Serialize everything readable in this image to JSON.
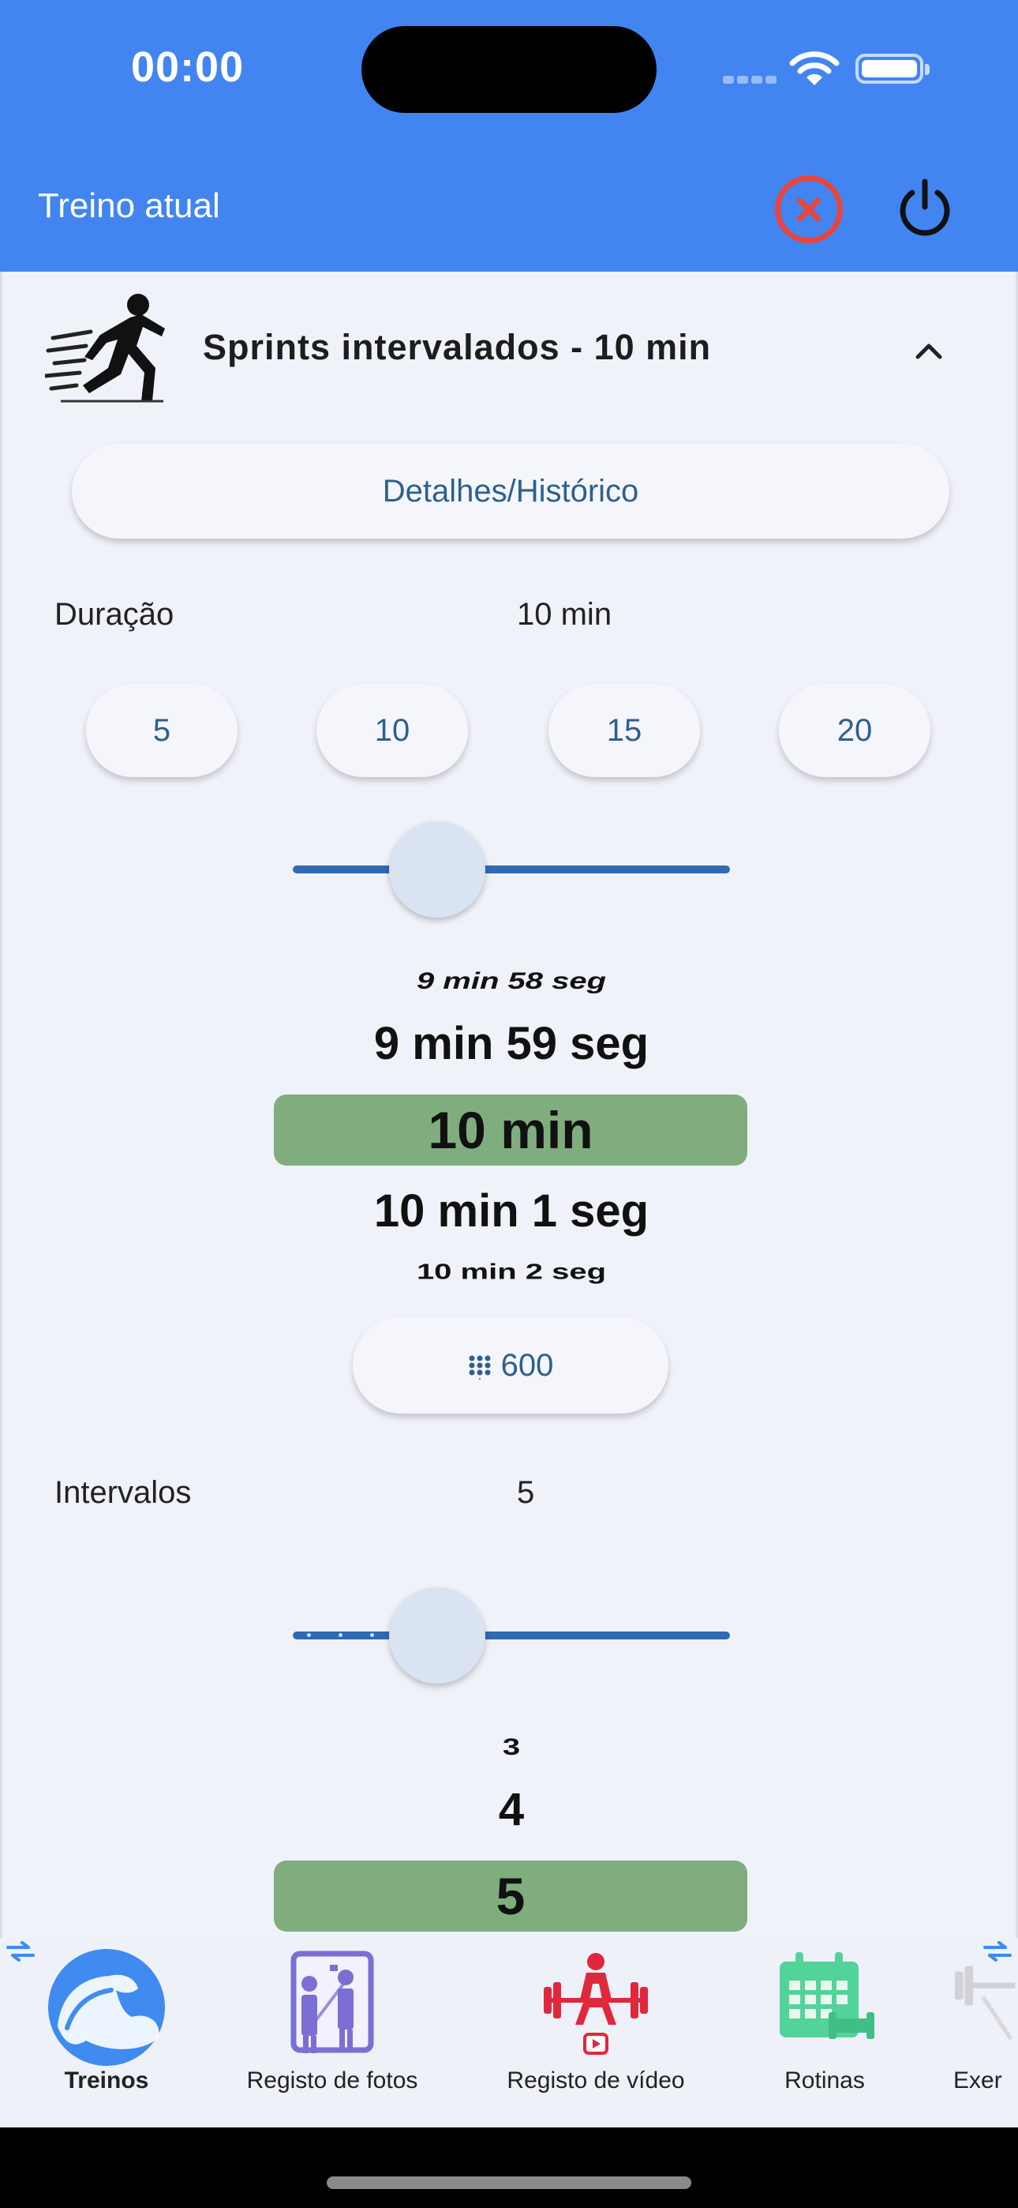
{
  "status_bar": {
    "time": "00:00"
  },
  "app_bar": {
    "title": "Treino atual"
  },
  "card": {
    "title": "Sprints intervalados - 10 min",
    "details_button": "Detalhes/Histórico",
    "duration": {
      "label": "Duração",
      "value": "10 min",
      "presets": [
        "5",
        "10",
        "15",
        "20"
      ],
      "slider_fraction": 0.33,
      "picker": [
        "9 min 58 seg",
        "9 min 59 seg",
        "10 min",
        "10 min 1 seg",
        "10 min 2 seg"
      ],
      "numeric_button": "600"
    },
    "intervals": {
      "label": "Intervalos",
      "value": "5",
      "slider_fraction": 0.33,
      "picker": [
        "3",
        "4",
        "5"
      ]
    }
  },
  "bottom_nav": {
    "items": [
      {
        "label": "Treinos",
        "icon": "biceps-icon",
        "active": true
      },
      {
        "label": "Registo de fotos",
        "icon": "photo-log-icon"
      },
      {
        "label": "Registo de vídeo",
        "icon": "weightlifting-video-icon"
      },
      {
        "label": "Rotinas",
        "icon": "calendar-icon"
      },
      {
        "label": "Exer",
        "icon": "dumbbell-icon"
      }
    ]
  },
  "colors": {
    "app_bar": "#4285f1",
    "close": "#e8453c",
    "picker_selected": "#80ad7e",
    "accent": "#2f6ab3",
    "photo_icon": "#7b6fd3",
    "video_icon": "#e0283c",
    "calendar_icon": "#52d39a"
  }
}
